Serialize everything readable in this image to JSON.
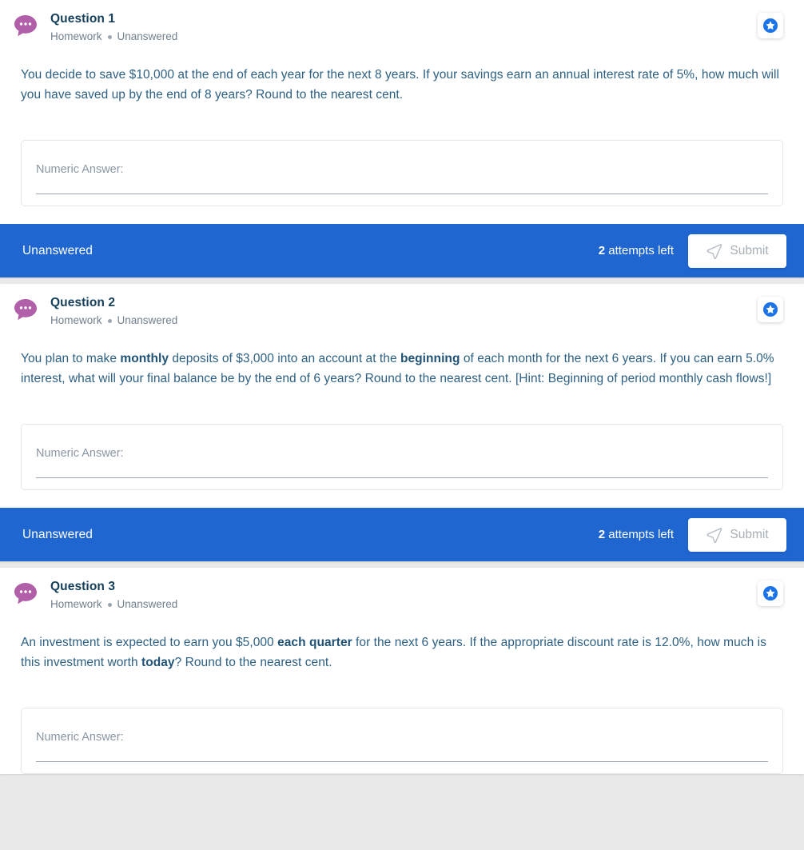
{
  "theme": {
    "accent_blue": "#1f66d0",
    "avatar_purple": "#b05fa8",
    "star_blue": "#1a73e8",
    "title_color": "#16405c",
    "body_color": "#2d6083",
    "meta_color": "#72808e"
  },
  "icons": {
    "avatar": "chat-bubble-ellipsis-icon",
    "bookmark": "star-badge-icon",
    "submit": "paper-plane-icon",
    "meta_separator": "bullet-dot-icon"
  },
  "answer_field": {
    "label": "Numeric Answer:",
    "placeholder": "",
    "value": ""
  },
  "questions": [
    {
      "title": "Question 1",
      "category": "Homework",
      "status": "Unanswered",
      "prompt_parts": [
        {
          "text": "You decide to save $10,000 at the end of each year for the next 8 years. If your savings earn an annual interest rate of 5%, how much will you have saved up by the end of 8 years? Round to the nearest cent.",
          "bold": false
        }
      ],
      "answer_label": "Numeric Answer:",
      "answer_value": "",
      "footer": {
        "status": "Unanswered",
        "attempts_count": "2",
        "attempts_text": "attempts left",
        "submit_label": "Submit",
        "submit_enabled": false
      }
    },
    {
      "title": "Question 2",
      "category": "Homework",
      "status": "Unanswered",
      "prompt_parts": [
        {
          "text": "You plan to make ",
          "bold": false
        },
        {
          "text": "monthly",
          "bold": true
        },
        {
          "text": " deposits of $3,000 into an account at the ",
          "bold": false
        },
        {
          "text": "beginning",
          "bold": true
        },
        {
          "text": " of each month for the next 6 years. If you can earn 5.0% interest, what will your final balance be by the end of 6 years? Round to the nearest cent. [Hint: Beginning of period monthly cash flows!]",
          "bold": false
        }
      ],
      "answer_label": "Numeric Answer:",
      "answer_value": "",
      "footer": {
        "status": "Unanswered",
        "attempts_count": "2",
        "attempts_text": "attempts left",
        "submit_label": "Submit",
        "submit_enabled": false
      }
    },
    {
      "title": "Question 3",
      "category": "Homework",
      "status": "Unanswered",
      "prompt_parts": [
        {
          "text": "An investment is expected to earn you $5,000 ",
          "bold": false
        },
        {
          "text": "each quarter",
          "bold": true
        },
        {
          "text": " for the next 6 years. If the appropriate discount rate is 12.0%, how much is this investment worth ",
          "bold": false
        },
        {
          "text": "today",
          "bold": true
        },
        {
          "text": "? Round to the nearest cent.",
          "bold": false
        }
      ],
      "answer_label": "Numeric Answer:",
      "answer_value": "",
      "footer": null
    }
  ]
}
